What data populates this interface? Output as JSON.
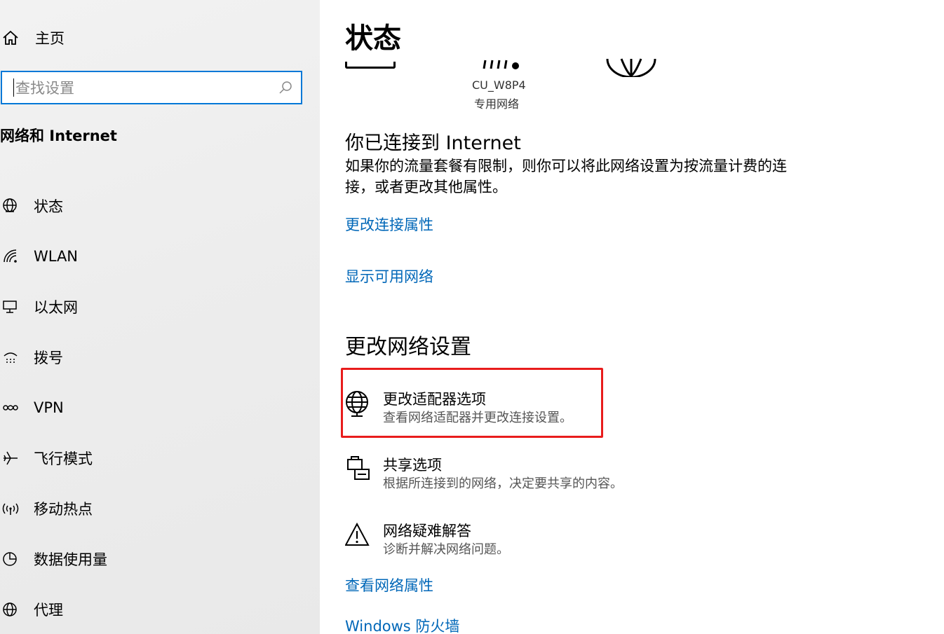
{
  "sidebar": {
    "home_label": "主页",
    "search_placeholder": "查找设置",
    "section_title": "网络和 Internet",
    "items": [
      {
        "label": "状态",
        "icon": "globe-icon"
      },
      {
        "label": "WLAN",
        "icon": "wifi-icon"
      },
      {
        "label": "以太网",
        "icon": "ethernet-icon"
      },
      {
        "label": "拨号",
        "icon": "dialup-icon"
      },
      {
        "label": "VPN",
        "icon": "vpn-icon"
      },
      {
        "label": "飞行模式",
        "icon": "airplane-icon"
      },
      {
        "label": "移动热点",
        "icon": "hotspot-icon"
      },
      {
        "label": "数据使用量",
        "icon": "data-usage-icon"
      },
      {
        "label": "代理",
        "icon": "globe-icon"
      }
    ]
  },
  "main": {
    "title": "状态",
    "network_name": "CU_W8P4",
    "network_type": "专用网络",
    "connected_heading": "你已连接到 Internet",
    "connected_desc": "如果你的流量套餐有限制，则你可以将此网络设置为按流量计费的连接，或者更改其他属性。",
    "link_change_props": "更改连接属性",
    "link_show_networks": "显示可用网络",
    "change_heading": "更改网络设置",
    "options": [
      {
        "title": "更改适配器选项",
        "desc": "查看网络适配器并更改连接设置。",
        "icon": "adapter-globe-icon"
      },
      {
        "title": "共享选项",
        "desc": "根据所连接到的网络，决定要共享的内容。",
        "icon": "sharing-icon"
      },
      {
        "title": "网络疑难解答",
        "desc": "诊断并解决网络问题。",
        "icon": "warning-icon"
      }
    ],
    "link_view_props": "查看网络属性",
    "link_firewall": "Windows 防火墙"
  },
  "colors": {
    "accent": "#0078d7",
    "link": "#0067b8",
    "highlight": "#e81c1c"
  }
}
